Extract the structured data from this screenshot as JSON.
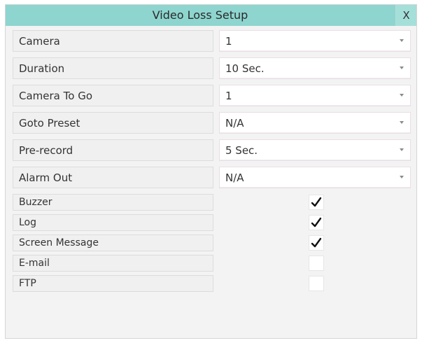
{
  "dialog": {
    "title": "Video Loss Setup",
    "close_label": "X"
  },
  "settings": [
    {
      "label": "Camera",
      "value": "1"
    },
    {
      "label": "Duration",
      "value": "10 Sec."
    },
    {
      "label": "Camera To Go",
      "value": "1"
    },
    {
      "label": "Goto Preset",
      "value": "N/A"
    },
    {
      "label": "Pre-record",
      "value": "5 Sec."
    },
    {
      "label": "Alarm Out",
      "value": "N/A"
    }
  ],
  "options": [
    {
      "label": "Buzzer",
      "checked": true
    },
    {
      "label": "Log",
      "checked": true
    },
    {
      "label": "Screen Message",
      "checked": true
    },
    {
      "label": "E-mail",
      "checked": false
    },
    {
      "label": "FTP",
      "checked": false
    }
  ],
  "icons": {
    "dropdown": "chevron-down-icon",
    "check": "checkmark-icon"
  },
  "colors": {
    "titlebar": "#8ed5cf",
    "panel": "#f3f3f3"
  }
}
